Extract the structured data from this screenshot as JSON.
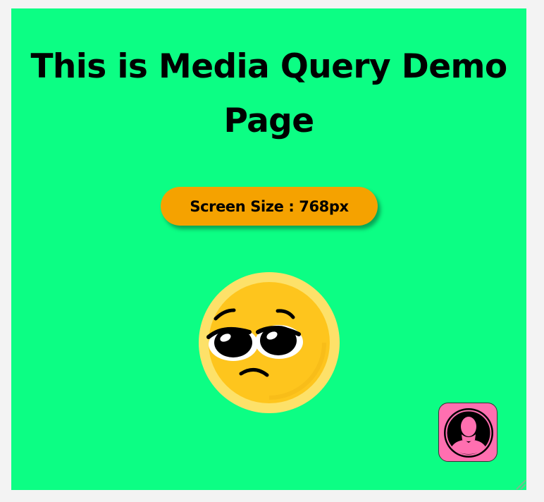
{
  "page": {
    "title": "This is Media Query Demo Page",
    "background_color": "#0cfe84"
  },
  "screen_badge": {
    "text": "Screen Size : 768px",
    "color": "#f5a200"
  },
  "emoji": {
    "icon": "pleading-face-icon"
  },
  "avatar": {
    "icon": "user-silhouette-icon",
    "color": "#ff6fb0"
  }
}
